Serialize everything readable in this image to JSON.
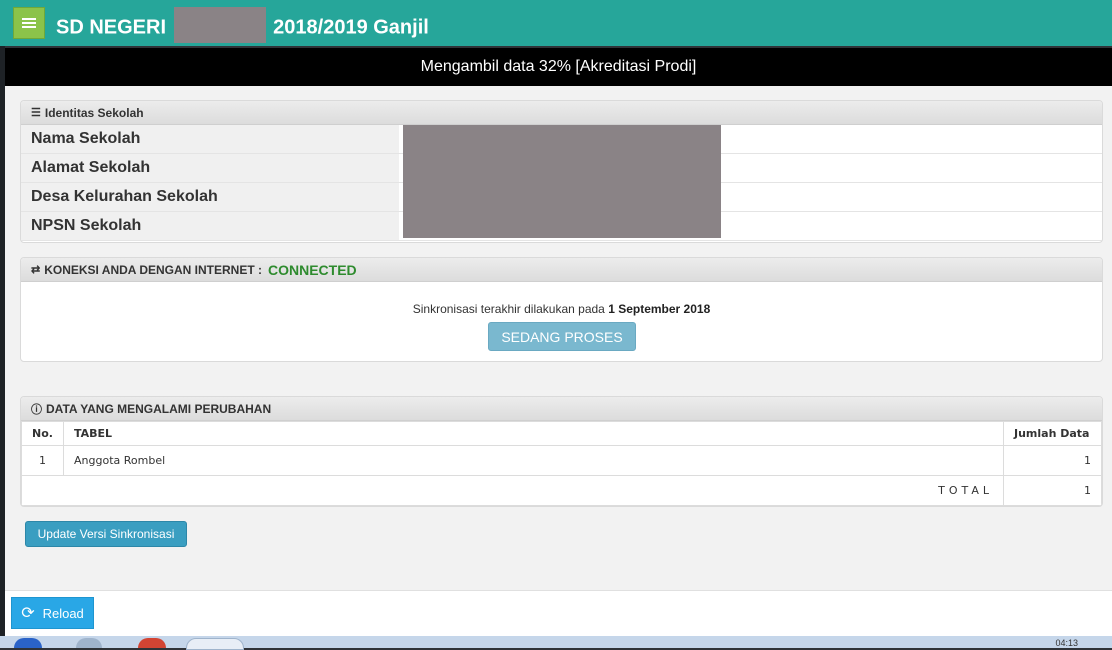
{
  "header": {
    "title_prefix": "SD NEGERI",
    "title_suffix": "2018/2019 Ganjil"
  },
  "progress": {
    "text": "Mengambil data 32% [Akreditasi Prodi]",
    "percent": 32
  },
  "identitas": {
    "title": "Identitas Sekolah",
    "rows": [
      {
        "label": "Nama Sekolah"
      },
      {
        "label": "Alamat Sekolah"
      },
      {
        "label": "Desa Kelurahan Sekolah"
      },
      {
        "label": "NPSN Sekolah"
      }
    ]
  },
  "koneksi": {
    "title": "KONEKSI ANDA DENGAN INTERNET :",
    "status": "CONNECTED",
    "status_color": "#2e8b2e",
    "sync_prefix": "Sinkronisasi terakhir dilakukan pada",
    "sync_date": "1 September 2018",
    "process_button": "SEDANG PROSES"
  },
  "perubahan": {
    "title": "DATA YANG MENGALAMI PERUBAHAN",
    "columns": [
      "No.",
      "TABEL",
      "Jumlah Data"
    ],
    "rows": [
      {
        "no": "1",
        "tabel": "Anggota Rombel",
        "jumlah": "1"
      }
    ],
    "total_label": "TOTAL",
    "total_value": "1"
  },
  "update_button": "Update Versi Sinkronisasi",
  "reload_button": "Reload",
  "taskbar": {
    "clock": "04:13"
  },
  "colors": {
    "topbar": "#26a69a",
    "menu_button": "#8bc34a",
    "reload": "#29a7e6",
    "update": "#3a9ec1"
  }
}
